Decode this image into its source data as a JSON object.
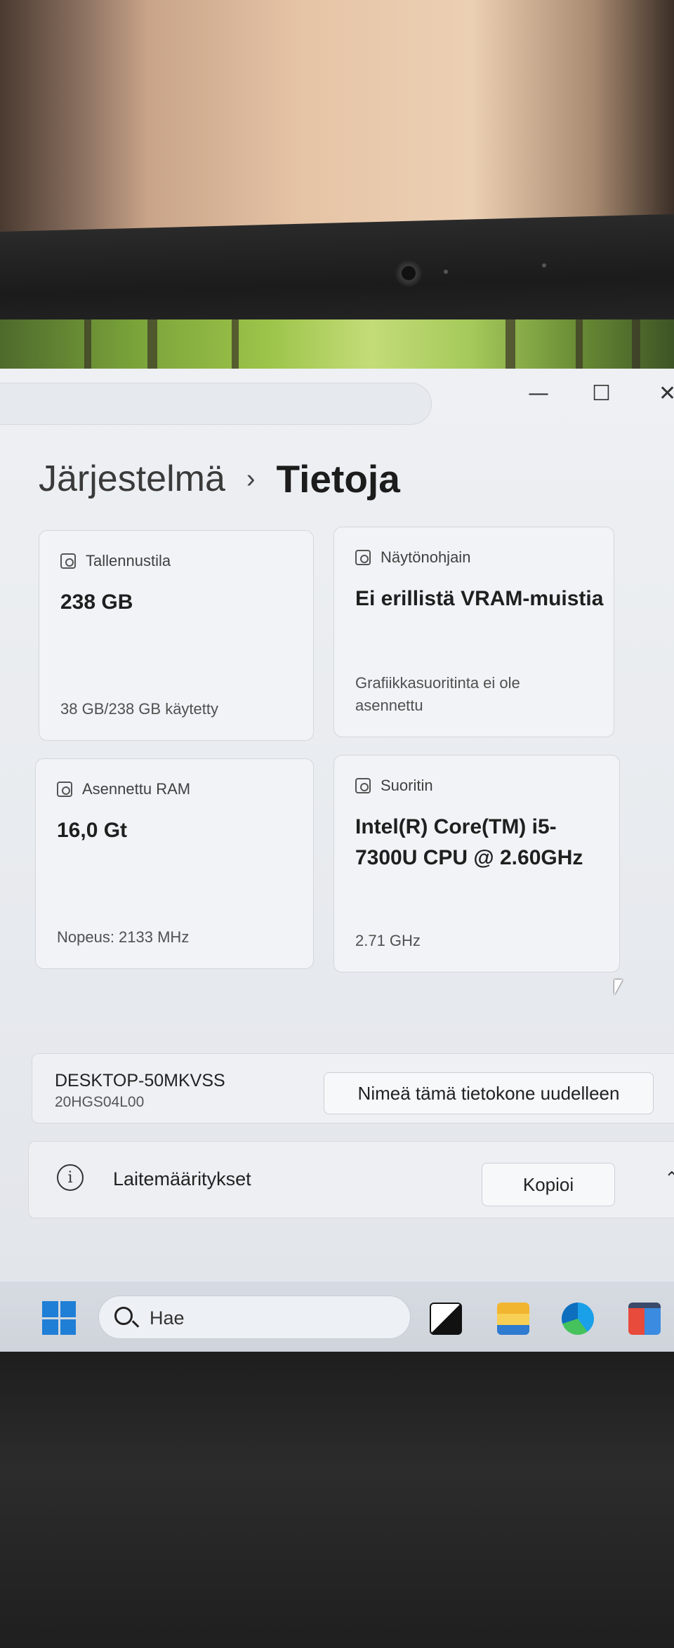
{
  "breadcrumb": {
    "parent": "Järjestelmä",
    "separator": "›",
    "current": "Tietoja"
  },
  "window_controls": {
    "minimize": "—",
    "maximize": "☐",
    "close": "✕"
  },
  "cards": [
    {
      "title": "Tallennustila",
      "value": "238 GB",
      "footer": "38 GB/238 GB käytetty",
      "icon": "hard-drive-icon"
    },
    {
      "title": "Näytönohjain",
      "value": "Ei erillistä VRAM-muistia",
      "footer": "Grafiikkasuoritinta ei ole asennettu",
      "icon": "graphics-card-icon"
    },
    {
      "title": "Asennettu RAM",
      "value": "16,0 Gt",
      "footer": "Nopeus: 2133 MHz",
      "icon": "memory-icon"
    },
    {
      "title": "Suoritin",
      "value": "Intel(R) Core(TM) i5-7300U CPU @ 2.60GHz",
      "footer": "2.71 GHz",
      "icon": "processor-icon"
    }
  ],
  "device": {
    "name": "DESKTOP-50MKVSS",
    "model": "20HGS04L00",
    "rename_label": "Nimeä tämä tietokone uudelleen"
  },
  "specs": {
    "label": "Laitemääritykset",
    "copy_label": "Kopioi",
    "chevron": "⌃"
  },
  "taskbar": {
    "search_placeholder": "Hae"
  }
}
